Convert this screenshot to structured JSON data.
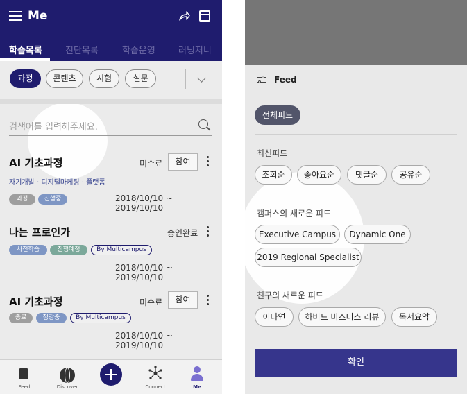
{
  "left": {
    "title": "Me",
    "tabs": [
      "학습목록",
      "진단목록",
      "학습운영",
      "러닝저니"
    ],
    "filter_chips": [
      "과정",
      "콘텐츠",
      "시험",
      "설문"
    ],
    "search_placeholder": "검색어를 입력해주세요.",
    "cards": [
      {
        "title": "AI 기초과정",
        "status": "미수료",
        "join_label": "참여",
        "subtitle": "자기개발 · 디지털마케팅 · 플랫폼",
        "tags": [
          "과정",
          "진행중"
        ],
        "date": "2018/10/10 ~ 2019/10/10"
      },
      {
        "title": "나는 프로인가",
        "status": "승인완료",
        "tags": [
          "사전학습",
          "진행예정",
          "By Multicampus"
        ],
        "date": "2018/10/10 ~ 2019/10/10"
      },
      {
        "title": "AI 기초과정",
        "status": "미수료",
        "join_label": "참여",
        "tags": [
          "종료",
          "청강중",
          "By Multicampus"
        ],
        "date": "2018/10/10 ~ 2019/10/10"
      }
    ],
    "bottom_nav": [
      "Feed",
      "Discover",
      "",
      "Connect",
      "Me"
    ]
  },
  "right": {
    "sheet_title": "Feed",
    "all_feed": "전체피드",
    "recent_label": "최신피드",
    "recent_options": [
      "조회순",
      "좋아요순",
      "댓글순",
      "공유순"
    ],
    "campus_label": "캠퍼스의 새로운 피드",
    "campus_options": [
      "Executive Campus",
      "Dynamic One",
      "2019 Regional Specialist"
    ],
    "friends_label": "친구의 새로운 피드",
    "friends_options": [
      "이나연",
      "하버드 비즈니스 리뷰",
      "독서요약"
    ],
    "confirm_label": "확인"
  },
  "colors": {
    "primary": "#1f1c6e",
    "confirm": "#36358c",
    "selected_pill": "#52556a"
  }
}
